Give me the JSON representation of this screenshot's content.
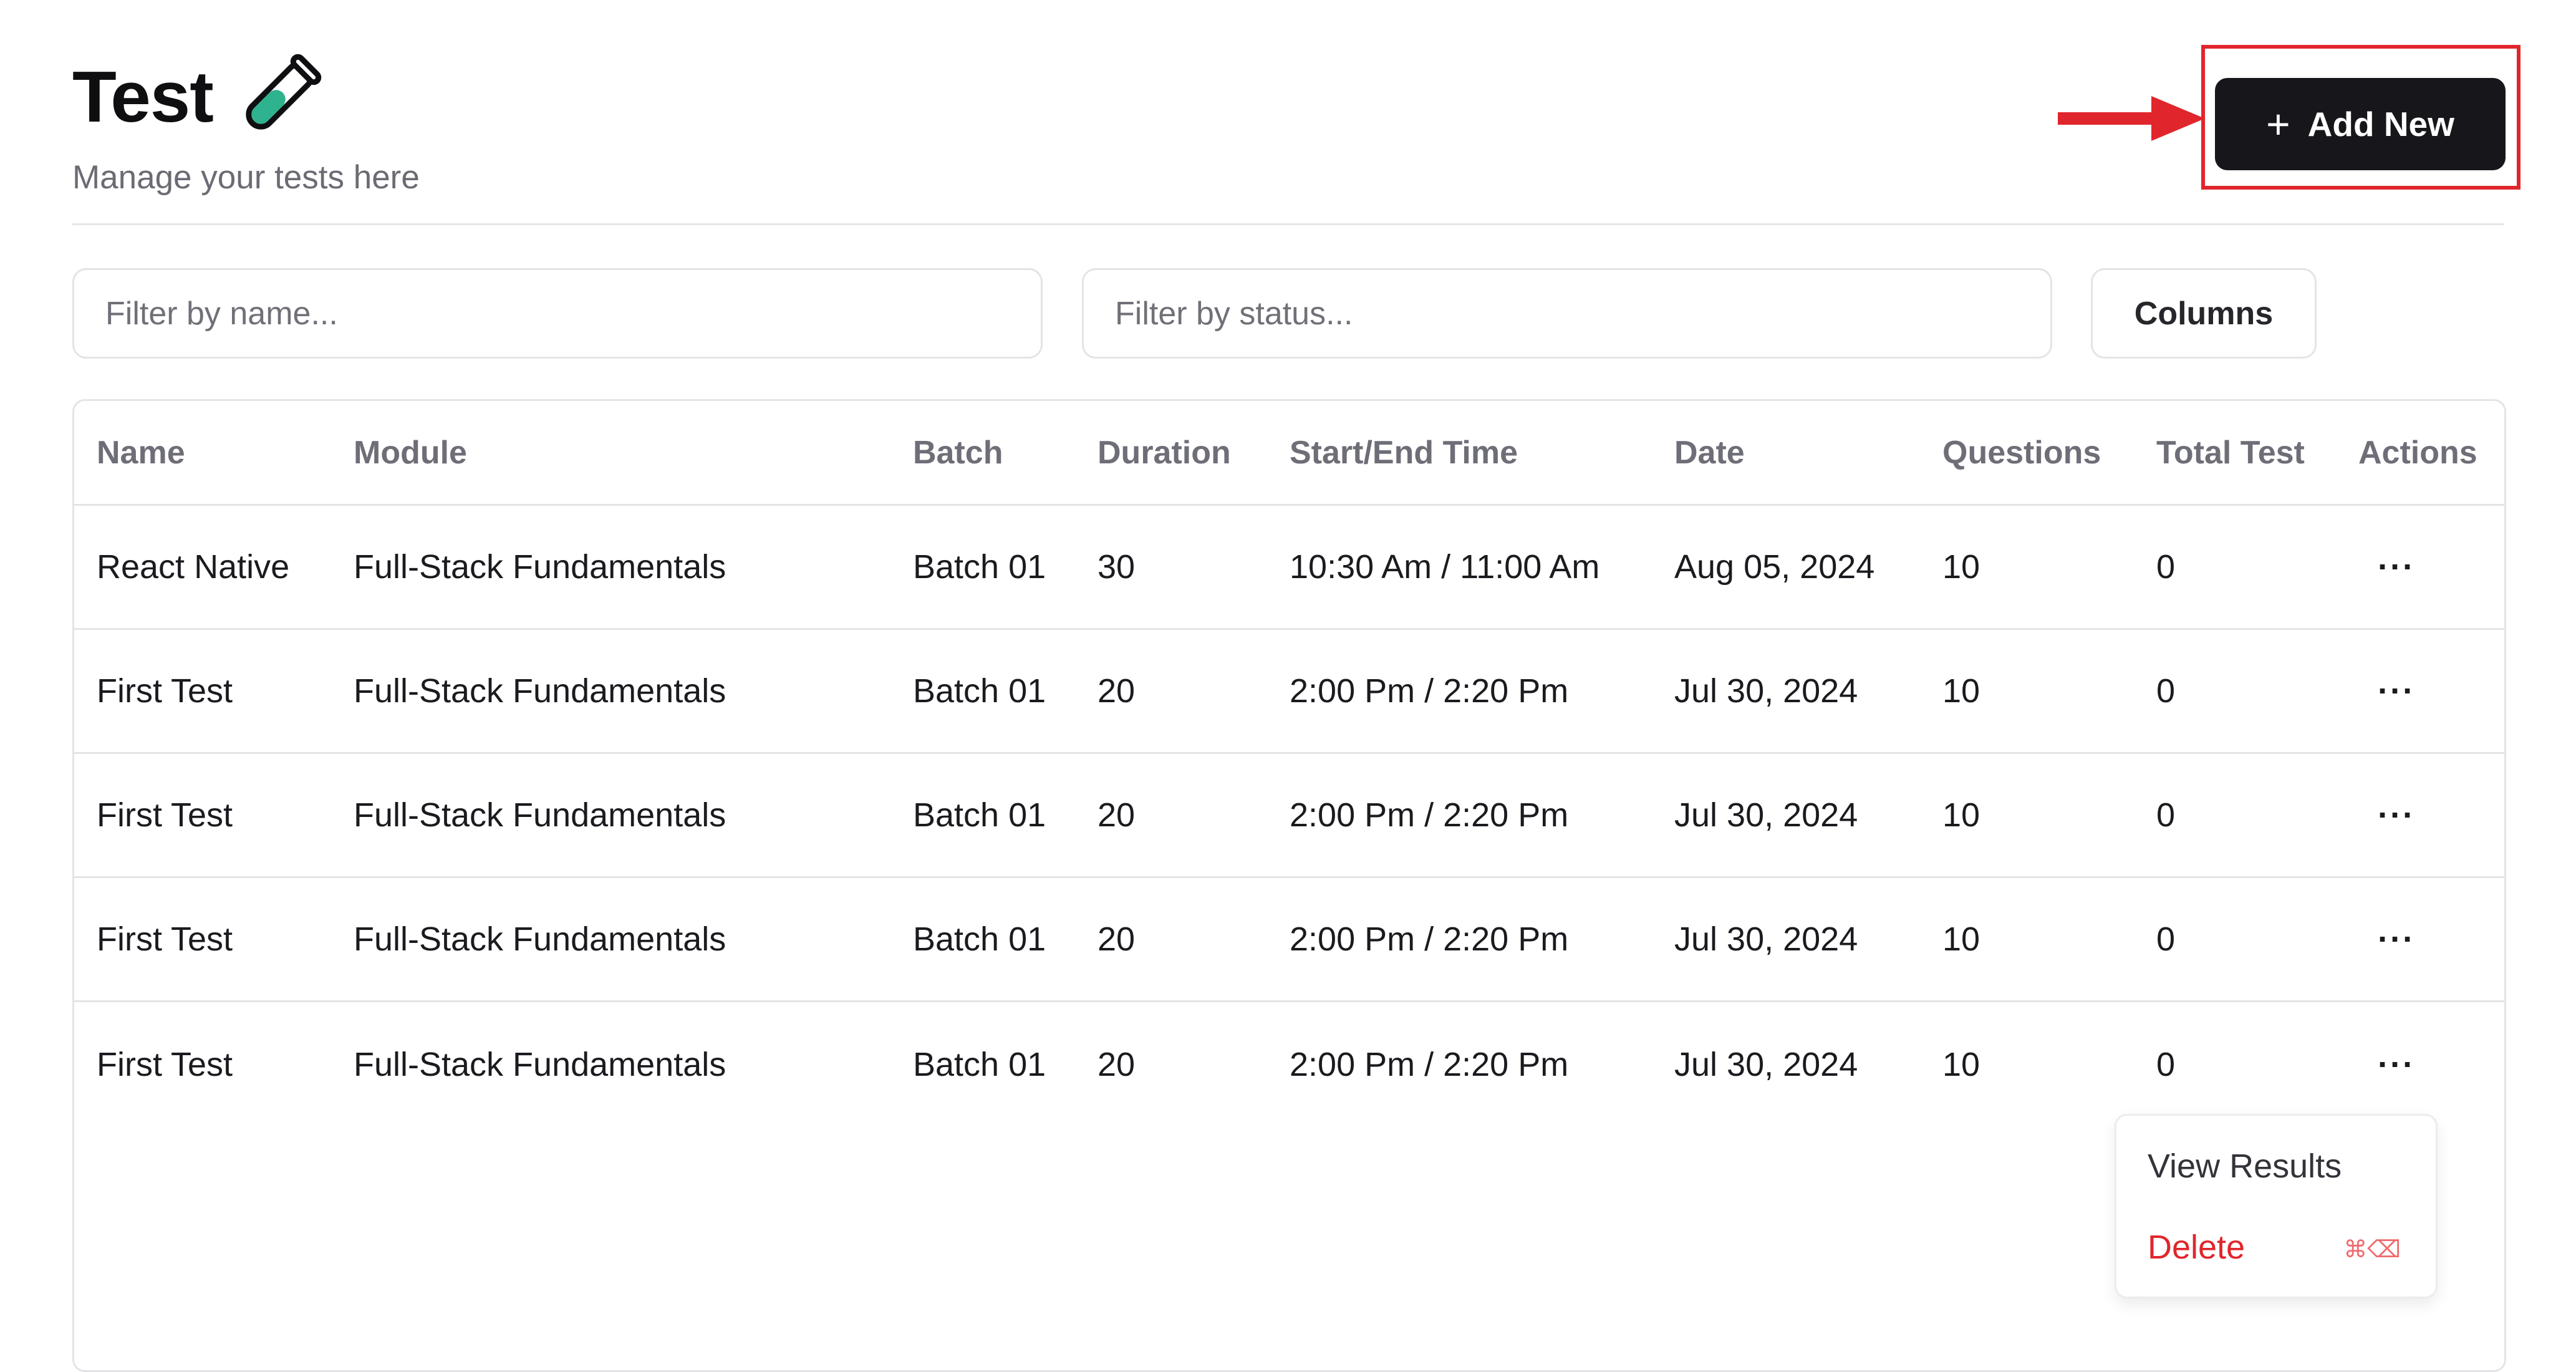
{
  "header": {
    "title": "Test",
    "subtitle": "Manage your tests here",
    "title_icon": "test-tube-icon"
  },
  "toolbar": {
    "add_new_label": "Add New",
    "add_new_icon": "plus-icon"
  },
  "filters": {
    "name_placeholder": "Filter by name...",
    "status_placeholder": "Filter by status...",
    "columns_label": "Columns"
  },
  "table": {
    "headers": [
      "Name",
      "Module",
      "Batch",
      "Duration",
      "Start/End Time",
      "Date",
      "Questions",
      "Total Test",
      "Actions"
    ],
    "rows": [
      {
        "name": "React Native",
        "module": "Full-Stack Fundamentals",
        "batch": "Batch 01",
        "duration": "30",
        "time": "10:30 Am / 11:00 Am",
        "date": "Aug 05, 2024",
        "questions": "10",
        "total": "0",
        "actions": "···"
      },
      {
        "name": "First Test",
        "module": "Full-Stack Fundamentals",
        "batch": "Batch 01",
        "duration": "20",
        "time": "2:00 Pm / 2:20 Pm",
        "date": "Jul 30, 2024",
        "questions": "10",
        "total": "0",
        "actions": "···"
      },
      {
        "name": "First Test",
        "module": "Full-Stack Fundamentals",
        "batch": "Batch 01",
        "duration": "20",
        "time": "2:00 Pm / 2:20 Pm",
        "date": "Jul 30, 2024",
        "questions": "10",
        "total": "0",
        "actions": "···"
      },
      {
        "name": "First Test",
        "module": "Full-Stack Fundamentals",
        "batch": "Batch 01",
        "duration": "20",
        "time": "2:00 Pm / 2:20 Pm",
        "date": "Jul 30, 2024",
        "questions": "10",
        "total": "0",
        "actions": "···"
      },
      {
        "name": "First Test",
        "module": "Full-Stack Fundamentals",
        "batch": "Batch 01",
        "duration": "20",
        "time": "2:00 Pm / 2:20 Pm",
        "date": "Jul 30, 2024",
        "questions": "10",
        "total": "0",
        "actions": "···"
      }
    ]
  },
  "actions_menu": {
    "view_results": "View Results",
    "delete": "Delete",
    "delete_shortcut": "⌘⌫"
  },
  "colors": {
    "primary_button": "#17171b",
    "annotation_red": "#e0262c",
    "delete_text": "#e0262c",
    "border": "#e4e4e7"
  }
}
